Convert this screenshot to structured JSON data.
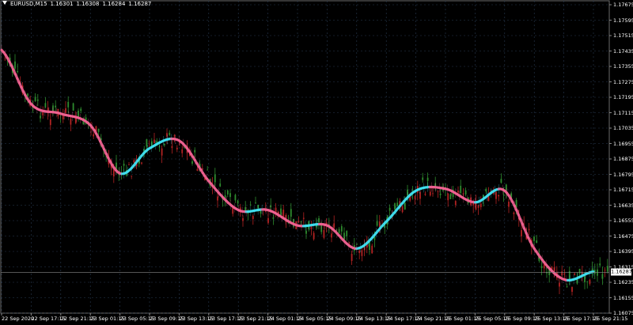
{
  "header": {
    "symbol": "EURUSD,M15",
    "open": "1.16301",
    "high": "1.16308",
    "low": "1.16284",
    "close": "1.16287",
    "dropdown_icon": "triangle-down-icon"
  },
  "price_axis": {
    "labels": [
      "1.17675",
      "1.17595",
      "1.17515",
      "1.17435",
      "1.17355",
      "1.17275",
      "1.17195",
      "1.17115",
      "1.17035",
      "1.16955",
      "1.16875",
      "1.16795",
      "1.16715",
      "1.16635",
      "1.16555",
      "1.16475",
      "1.16395",
      "1.16315",
      "1.16235",
      "1.16155",
      "1.16075"
    ],
    "current_price": "1.16287"
  },
  "time_axis": {
    "labels": [
      "22 Sep 2020",
      "22 Sep 17:15",
      "22 Sep 21:15",
      "23 Sep 01:15",
      "23 Sep 05:15",
      "23 Sep 09:15",
      "23 Sep 13:15",
      "23 Sep 17:15",
      "23 Sep 21:15",
      "24 Sep 01:15",
      "24 Sep 05:15",
      "24 Sep 09:15",
      "24 Sep 13:15",
      "24 Sep 17:15",
      "24 Sep 21:15",
      "25 Sep 01:15",
      "25 Sep 05:15",
      "25 Sep 09:15",
      "25 Sep 13:15",
      "25 Sep 17:15",
      "25 Sep 21:15"
    ]
  },
  "colors": {
    "background": "#000000",
    "grid": "#283a52",
    "bull_candle": "#2e8b2e",
    "bear_candle": "#b22222",
    "ma_up": "#40e0f0",
    "ma_down": "#f06292",
    "axis_text": "#ffffff"
  },
  "chart_data": {
    "type": "line",
    "title": "",
    "xlabel": "",
    "ylabel": "",
    "ylim": [
      1.16075,
      1.17675
    ],
    "x": [
      "22 Sep 2020",
      "22 Sep 17:15",
      "22 Sep 21:15",
      "23 Sep 01:15",
      "23 Sep 05:15",
      "23 Sep 09:15",
      "23 Sep 13:15",
      "23 Sep 17:15",
      "23 Sep 21:15",
      "24 Sep 01:15",
      "24 Sep 05:15",
      "24 Sep 09:15",
      "24 Sep 13:15",
      "24 Sep 17:15",
      "24 Sep 21:15",
      "25 Sep 01:15",
      "25 Sep 05:15",
      "25 Sep 09:15",
      "25 Sep 13:15",
      "25 Sep 17:15",
      "25 Sep 21:15"
    ],
    "series": [
      {
        "values": [
          1.1744,
          1.1716,
          1.1711,
          1.1705,
          1.168,
          1.1693,
          1.1697,
          1.1676,
          1.1661,
          1.1661,
          1.1653,
          1.1653,
          1.1641,
          1.1655,
          1.1671,
          1.1672,
          1.1665,
          1.1671,
          1.1641,
          1.1625,
          1.1629
        ]
      }
    ]
  }
}
